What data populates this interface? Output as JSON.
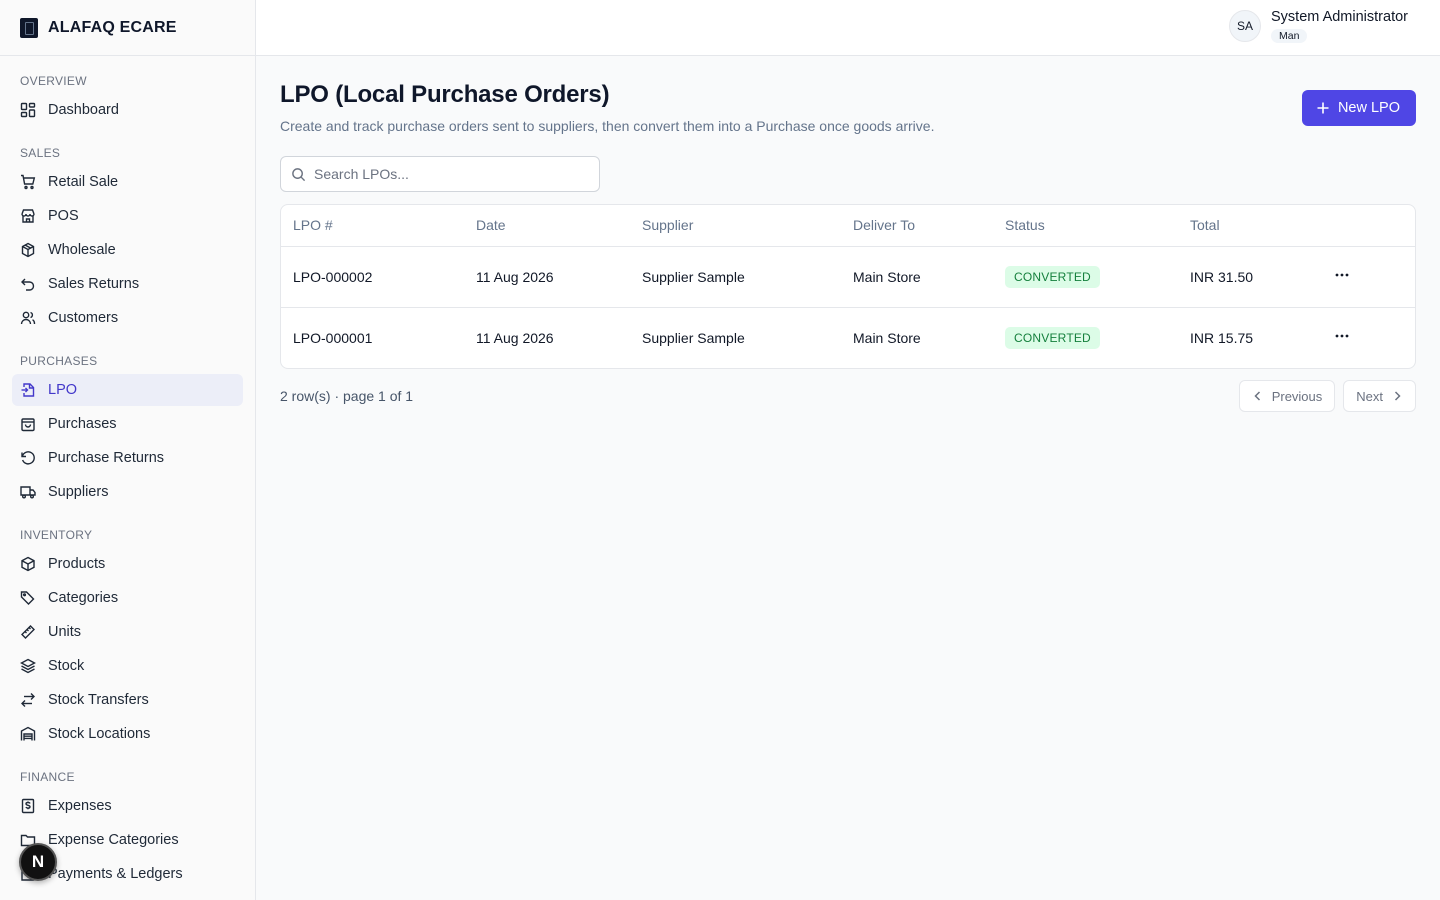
{
  "app": {
    "brand": "ALAFAQ ECARE",
    "floating_badge": "N"
  },
  "sidebar": {
    "sections": [
      {
        "title": "OVERVIEW",
        "items": [
          {
            "label": "Dashboard",
            "icon": "dashboard-icon"
          }
        ]
      },
      {
        "title": "SALES",
        "items": [
          {
            "label": "Retail Sale",
            "icon": "cart-icon"
          },
          {
            "label": "POS",
            "icon": "store-icon"
          },
          {
            "label": "Wholesale",
            "icon": "boxes-icon"
          },
          {
            "label": "Sales Returns",
            "icon": "undo-icon"
          },
          {
            "label": "Customers",
            "icon": "users-icon"
          }
        ]
      },
      {
        "title": "PURCHASES",
        "items": [
          {
            "label": "LPO",
            "icon": "file-import-icon",
            "active": true
          },
          {
            "label": "Purchases",
            "icon": "shopping-bag-icon"
          },
          {
            "label": "Purchase Returns",
            "icon": "rotate-ccw-icon"
          },
          {
            "label": "Suppliers",
            "icon": "truck-icon"
          }
        ]
      },
      {
        "title": "INVENTORY",
        "items": [
          {
            "label": "Products",
            "icon": "package-icon"
          },
          {
            "label": "Categories",
            "icon": "tags-icon"
          },
          {
            "label": "Units",
            "icon": "ruler-icon"
          },
          {
            "label": "Stock",
            "icon": "layers-icon"
          },
          {
            "label": "Stock Transfers",
            "icon": "arrows-left-right-icon"
          },
          {
            "label": "Stock Locations",
            "icon": "warehouse-icon"
          }
        ]
      },
      {
        "title": "FINANCE",
        "items": [
          {
            "label": "Expenses",
            "icon": "receipt-dollar-icon"
          },
          {
            "label": "Expense Categories",
            "icon": "folder-icon"
          },
          {
            "label": "Payments & Ledgers",
            "icon": "wallet-icon"
          }
        ]
      }
    ]
  },
  "header": {
    "avatar_initials": "SA",
    "user_name": "System Administrator",
    "user_role": "Man"
  },
  "page": {
    "title": "LPO (Local Purchase Orders)",
    "subtitle": "Create and track purchase orders sent to suppliers, then convert them into a Purchase once goods arrive.",
    "new_button": "New LPO",
    "search_placeholder": "Search LPOs..."
  },
  "table": {
    "columns": [
      "LPO #",
      "Date",
      "Supplier",
      "Deliver To",
      "Status",
      "Total"
    ],
    "rows": [
      {
        "lpo": "LPO-000002",
        "date": "11 Aug 2026",
        "supplier": "Supplier Sample",
        "deliver_to": "Main Store",
        "status": "CONVERTED",
        "total": "INR 31.50"
      },
      {
        "lpo": "LPO-000001",
        "date": "11 Aug 2026",
        "supplier": "Supplier Sample",
        "deliver_to": "Main Store",
        "status": "CONVERTED",
        "total": "INR 15.75"
      }
    ]
  },
  "pagination": {
    "info": "2 row(s) · page 1 of 1",
    "previous": "Previous",
    "next": "Next"
  },
  "colors": {
    "accent": "#4f46e5",
    "active_bg": "#eceef8",
    "status_green": "#15803d",
    "status_green_bg": "#dcfce7"
  }
}
